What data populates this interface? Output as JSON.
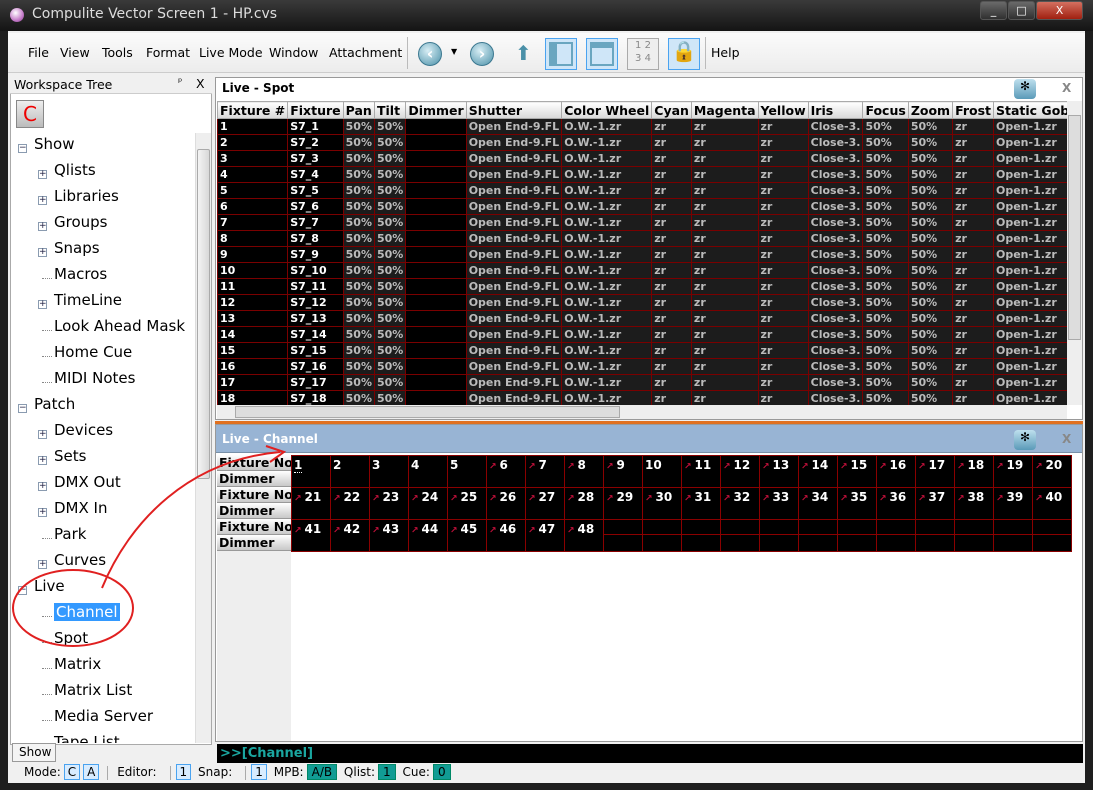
{
  "window": {
    "title": "Compulite Vector Screen 1 - HP.cvs",
    "minimize": "_",
    "maximize": "□",
    "close": "X"
  },
  "menu": [
    "File",
    "View",
    "Tools",
    "Format",
    "Live Mode",
    "Window",
    "Attachment",
    "Help"
  ],
  "toolbar": {
    "back": "back-icon",
    "forward": "forward-icon",
    "layout_numbers": [
      "1",
      "2",
      "3",
      "4"
    ]
  },
  "workspace": {
    "title": "Workspace Tree",
    "pin": "ᵖ",
    "close": "X",
    "c_button": "C",
    "tab": "Show",
    "items": [
      {
        "label": "Show",
        "level": 0,
        "exp": "-"
      },
      {
        "label": "Qlists",
        "level": 1,
        "exp": "+"
      },
      {
        "label": "Libraries",
        "level": 1,
        "exp": "+"
      },
      {
        "label": "Groups",
        "level": 1,
        "exp": "+"
      },
      {
        "label": "Snaps",
        "level": 1,
        "exp": "+"
      },
      {
        "label": "Macros",
        "level": 1,
        "exp": ""
      },
      {
        "label": "TimeLine",
        "level": 1,
        "exp": "+"
      },
      {
        "label": "Look Ahead Mask",
        "level": 1,
        "exp": ""
      },
      {
        "label": "Home Cue",
        "level": 1,
        "exp": ""
      },
      {
        "label": "MIDI Notes",
        "level": 1,
        "exp": ""
      },
      {
        "label": "Patch",
        "level": 0,
        "exp": "-"
      },
      {
        "label": "Devices",
        "level": 1,
        "exp": "+"
      },
      {
        "label": "Sets",
        "level": 1,
        "exp": "+"
      },
      {
        "label": "DMX Out",
        "level": 1,
        "exp": "+"
      },
      {
        "label": "DMX In",
        "level": 1,
        "exp": "+"
      },
      {
        "label": "Park",
        "level": 1,
        "exp": ""
      },
      {
        "label": "Curves",
        "level": 1,
        "exp": "+"
      },
      {
        "label": "Live",
        "level": 0,
        "exp": "-"
      },
      {
        "label": "Channel",
        "level": 1,
        "exp": "",
        "selected": true
      },
      {
        "label": "Spot",
        "level": 1,
        "exp": ""
      },
      {
        "label": "Matrix",
        "level": 1,
        "exp": ""
      },
      {
        "label": "Matrix List",
        "level": 1,
        "exp": ""
      },
      {
        "label": "Media Server",
        "level": 1,
        "exp": ""
      },
      {
        "label": "Tape List",
        "level": 1,
        "exp": ""
      }
    ]
  },
  "spot": {
    "title": "Live - Spot",
    "close": "X",
    "columns": [
      "Fixture #",
      "Fixture",
      "Pan",
      "Tilt",
      "Dimmer",
      "Shutter",
      "Color Wheel",
      "Cyan",
      "Magenta",
      "Yellow",
      "Iris",
      "Focus",
      "Zoom",
      "Frost",
      "Static Gobo Whe"
    ],
    "rows": [
      [
        "1",
        "S7_1",
        "50%",
        "50%",
        "",
        "Open End-9.FL",
        "O.W.-1.zr",
        "zr",
        "zr",
        "zr",
        "Close-3.",
        "50%",
        "50%",
        "zr",
        "Open-1.zr"
      ],
      [
        "2",
        "S7_2",
        "50%",
        "50%",
        "",
        "Open End-9.FL",
        "O.W.-1.zr",
        "zr",
        "zr",
        "zr",
        "Close-3.",
        "50%",
        "50%",
        "zr",
        "Open-1.zr"
      ],
      [
        "3",
        "S7_3",
        "50%",
        "50%",
        "",
        "Open End-9.FL",
        "O.W.-1.zr",
        "zr",
        "zr",
        "zr",
        "Close-3.",
        "50%",
        "50%",
        "zr",
        "Open-1.zr"
      ],
      [
        "4",
        "S7_4",
        "50%",
        "50%",
        "",
        "Open End-9.FL",
        "O.W.-1.zr",
        "zr",
        "zr",
        "zr",
        "Close-3.",
        "50%",
        "50%",
        "zr",
        "Open-1.zr"
      ],
      [
        "5",
        "S7_5",
        "50%",
        "50%",
        "",
        "Open End-9.FL",
        "O.W.-1.zr",
        "zr",
        "zr",
        "zr",
        "Close-3.",
        "50%",
        "50%",
        "zr",
        "Open-1.zr"
      ],
      [
        "6",
        "S7_6",
        "50%",
        "50%",
        "",
        "Open End-9.FL",
        "O.W.-1.zr",
        "zr",
        "zr",
        "zr",
        "Close-3.",
        "50%",
        "50%",
        "zr",
        "Open-1.zr"
      ],
      [
        "7",
        "S7_7",
        "50%",
        "50%",
        "",
        "Open End-9.FL",
        "O.W.-1.zr",
        "zr",
        "zr",
        "zr",
        "Close-3.",
        "50%",
        "50%",
        "zr",
        "Open-1.zr"
      ],
      [
        "8",
        "S7_8",
        "50%",
        "50%",
        "",
        "Open End-9.FL",
        "O.W.-1.zr",
        "zr",
        "zr",
        "zr",
        "Close-3.",
        "50%",
        "50%",
        "zr",
        "Open-1.zr"
      ],
      [
        "9",
        "S7_9",
        "50%",
        "50%",
        "",
        "Open End-9.FL",
        "O.W.-1.zr",
        "zr",
        "zr",
        "zr",
        "Close-3.",
        "50%",
        "50%",
        "zr",
        "Open-1.zr"
      ],
      [
        "10",
        "S7_10",
        "50%",
        "50%",
        "",
        "Open End-9.FL",
        "O.W.-1.zr",
        "zr",
        "zr",
        "zr",
        "Close-3.",
        "50%",
        "50%",
        "zr",
        "Open-1.zr"
      ],
      [
        "11",
        "S7_11",
        "50%",
        "50%",
        "",
        "Open End-9.FL",
        "O.W.-1.zr",
        "zr",
        "zr",
        "zr",
        "Close-3.",
        "50%",
        "50%",
        "zr",
        "Open-1.zr"
      ],
      [
        "12",
        "S7_12",
        "50%",
        "50%",
        "",
        "Open End-9.FL",
        "O.W.-1.zr",
        "zr",
        "zr",
        "zr",
        "Close-3.",
        "50%",
        "50%",
        "zr",
        "Open-1.zr"
      ],
      [
        "13",
        "S7_13",
        "50%",
        "50%",
        "",
        "Open End-9.FL",
        "O.W.-1.zr",
        "zr",
        "zr",
        "zr",
        "Close-3.",
        "50%",
        "50%",
        "zr",
        "Open-1.zr"
      ],
      [
        "14",
        "S7_14",
        "50%",
        "50%",
        "",
        "Open End-9.FL",
        "O.W.-1.zr",
        "zr",
        "zr",
        "zr",
        "Close-3.",
        "50%",
        "50%",
        "zr",
        "Open-1.zr"
      ],
      [
        "15",
        "S7_15",
        "50%",
        "50%",
        "",
        "Open End-9.FL",
        "O.W.-1.zr",
        "zr",
        "zr",
        "zr",
        "Close-3.",
        "50%",
        "50%",
        "zr",
        "Open-1.zr"
      ],
      [
        "16",
        "S7_16",
        "50%",
        "50%",
        "",
        "Open End-9.FL",
        "O.W.-1.zr",
        "zr",
        "zr",
        "zr",
        "Close-3.",
        "50%",
        "50%",
        "zr",
        "Open-1.zr"
      ],
      [
        "17",
        "S7_17",
        "50%",
        "50%",
        "",
        "Open End-9.FL",
        "O.W.-1.zr",
        "zr",
        "zr",
        "zr",
        "Close-3.",
        "50%",
        "50%",
        "zr",
        "Open-1.zr"
      ],
      [
        "18",
        "S7_18",
        "50%",
        "50%",
        "",
        "Open End-9.FL",
        "O.W.-1.zr",
        "zr",
        "zr",
        "zr",
        "Close-3.",
        "50%",
        "50%",
        "zr",
        "Open-1.zr"
      ]
    ]
  },
  "channel": {
    "title": "Live - Channel",
    "close": "X",
    "row_labels": [
      "Fixture No",
      "Dimmer"
    ],
    "no_arrow": [
      1,
      2,
      3,
      4,
      5,
      10
    ],
    "count": 48
  },
  "command_line": ">>[Channel]",
  "status": {
    "mode_label": "Mode:",
    "mode": [
      "C",
      "A"
    ],
    "editor_label": "Editor:",
    "editor": "1",
    "snap_label": "Snap:",
    "snap": "1",
    "mpb_label": "MPB:",
    "mpb": "A/B",
    "qlist_label": "Qlist:",
    "qlist": "1",
    "cue_label": "Cue:",
    "cue": "0"
  },
  "colors": {
    "annotation": "#e02020",
    "grid_border": "#8a0000",
    "command_text": "#1aa6a0",
    "channel_header": "#98b4d4"
  }
}
